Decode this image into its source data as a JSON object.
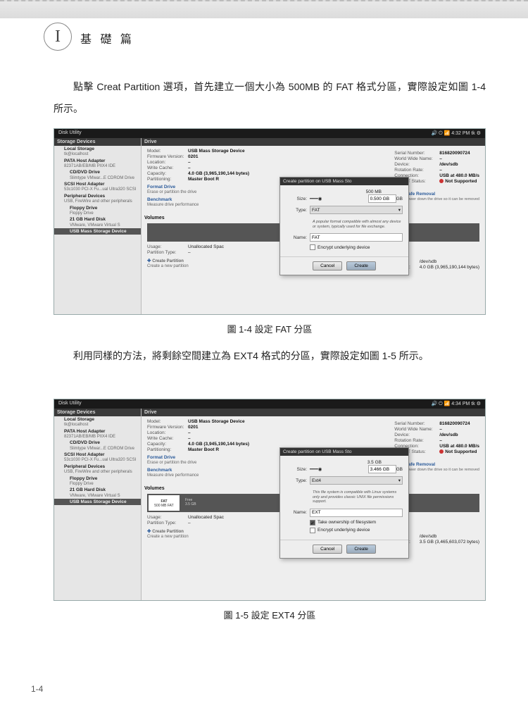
{
  "chapter": {
    "badge": "I",
    "title": "基 礎 篇"
  },
  "para1": "點擊 Creat Partition 選項，首先建立一個大小為 500MB 的 FAT 格式分區，實際設定如圖 1-4 所示。",
  "para2": "利用同樣的方法，將剩餘空間建立為 EXT4 格式的分區，實際設定如圖 1-5 所示。",
  "fig1": {
    "caption": "圖 1-4 設定 FAT 分區"
  },
  "fig2": {
    "caption": "圖 1-5 設定 EXT4 分區"
  },
  "page": "1-4",
  "du_title": "Disk Utility",
  "topbar": {
    "time1": "4:32 PM",
    "time2": "4:34 PM",
    "user": "tk"
  },
  "side": {
    "header": "Storage Devices",
    "items": [
      {
        "name": "Local Storage",
        "sub": "tk@localhost"
      },
      {
        "name": "PATA Host Adapter",
        "sub": "82371AB/EB/MB PIIX4 IDE"
      },
      {
        "name": "CD/DVD Drive",
        "sub": "Slimtype VMwar...E CDROM Drive"
      },
      {
        "name": "SCSI Host Adapter",
        "sub": "53c1030 PCI-X Fu...ual Ultra320 SCSI"
      },
      {
        "name": "Peripheral Devices",
        "sub": "USB, FireWire and other peripherals"
      },
      {
        "name": "Floppy Drive",
        "sub": "Floppy Drive"
      },
      {
        "name": "21 GB Hard Disk",
        "sub": "VMware, VMware Virtual S"
      },
      {
        "name": "USB Mass Storage Device",
        "sub": ""
      }
    ]
  },
  "drive": {
    "header": "Drive",
    "labels": {
      "model": "Model:",
      "fw": "Firmware Version:",
      "loc": "Location:",
      "wc": "Write Cache:",
      "cap": "Capacity:",
      "part": "Partitioning:",
      "serial": "Serial Number:",
      "wwn": "World Wide Name:",
      "dev": "Device:",
      "rot": "Rotation Rate:",
      "conn": "Connection:",
      "smart": "SMART Status:"
    },
    "values": {
      "model": "USB Mass Storage Device",
      "fw": "0201",
      "loc": "–",
      "wc": "–",
      "cap1": "4.0 GB (3,965,190,144 bytes)",
      "part": "Master Boot R",
      "serial": "816820090724",
      "wwn": "–",
      "dev": "/dev/sdb",
      "rot": "–",
      "conn": "USB at 480.0 MB/s",
      "smart": "Not Supported"
    },
    "cap2": "4.0 GB (3,945,190,144 bytes)"
  },
  "actions": {
    "fmt_t": "Format Drive",
    "fmt_s": "Erase or partition the drive",
    "bench_t": "Benchmark",
    "bench_s": "Measure drive performance",
    "safe_t": "Safe Removal",
    "safe_s": "Power down the drive so it can be removed",
    "cp_t": "Create Partition",
    "cp_s": "Create a new partition"
  },
  "vol": {
    "header": "Volumes",
    "usage_l": "Usage:",
    "usage_v": "Unallocated Spac",
    "pt_l": "Partition Type:",
    "pt_v": "–",
    "dev_l": "Device:",
    "dev1": "/dev/sdb",
    "dev2": "/dev/sdb",
    "cap_l": "Capacity:",
    "cap1": "4.0 GB (3,965,190,144 bytes)",
    "cap2": "3.5 GB (3,465,603,072 bytes)",
    "chip_fat": "FAT\n500 MB FAT",
    "chip_free": "Free\n3.5 GB"
  },
  "dlg": {
    "title": "Create partition on USB Mass Sto",
    "size_l": "Size:",
    "type_l": "Type:",
    "name_l": "Name:",
    "cancel": "Cancel",
    "create": "Create",
    "chk_enc": "Encrypt underlying device",
    "chk_own": "Take ownership of filesystem"
  },
  "dlg1": {
    "size_max": "500 MB",
    "size_v": "0.500 GB",
    "type": "FAT",
    "name": "FAT",
    "desc": "A popular format compatible with almost any device or system, typically used for file exchange."
  },
  "dlg2": {
    "size_max": "3.5 GB",
    "size_v": "3.466 GB",
    "type": "Ext4",
    "name": "EXT",
    "desc": "This file system is compatible with Linux systems only and provides classic UNIX file permissions support."
  }
}
